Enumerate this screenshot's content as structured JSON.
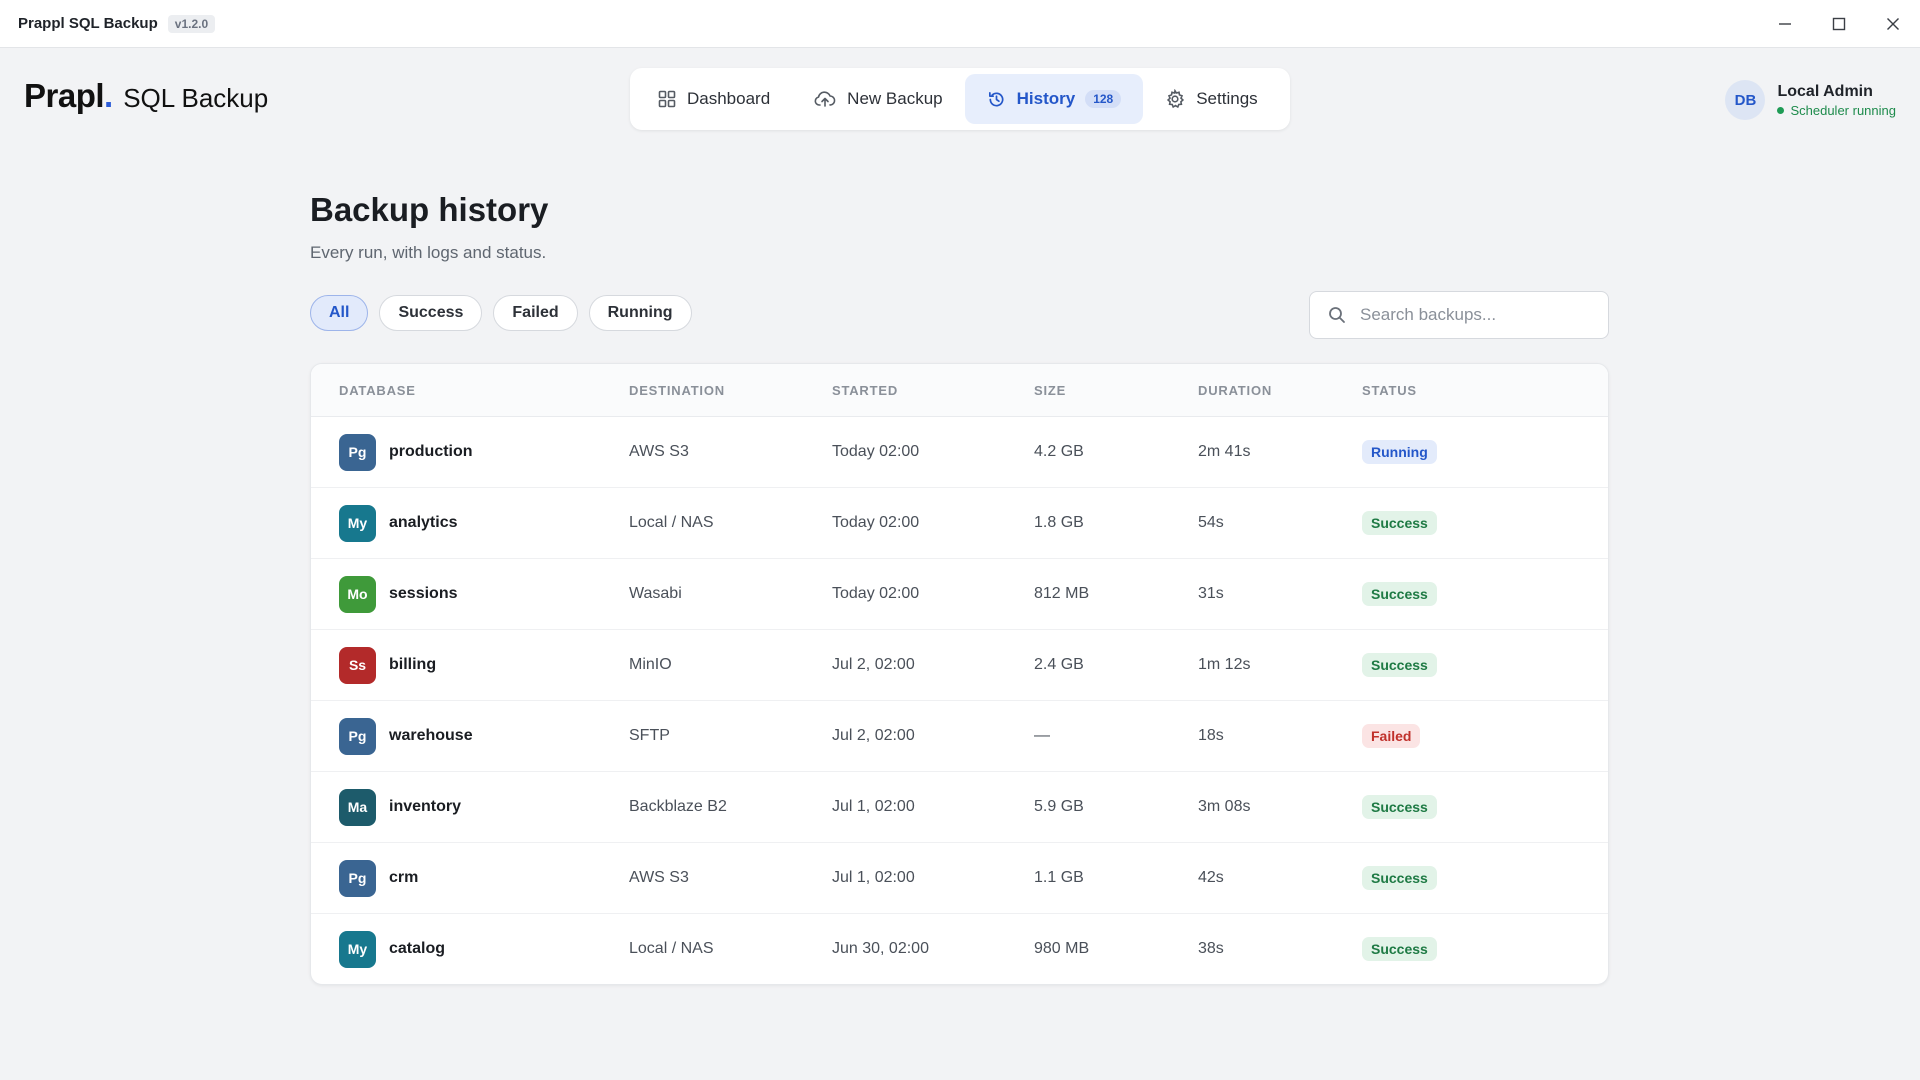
{
  "window": {
    "title": "Prappl SQL Backup",
    "version": "v1.2.0"
  },
  "brand": {
    "logo": "Prapl",
    "dot": ".",
    "product": "SQL Backup",
    "accent": "#2b5bd7"
  },
  "nav": {
    "items": [
      {
        "label": "Dashboard",
        "icon": "dashboard-icon"
      },
      {
        "label": "New Backup",
        "icon": "cloud-upload-icon"
      },
      {
        "label": "History",
        "icon": "history-icon",
        "badge": "128",
        "active": true
      },
      {
        "label": "Settings",
        "icon": "gear-icon"
      }
    ]
  },
  "user": {
    "initials": "DB",
    "name": "Local Admin",
    "status": "Scheduler running"
  },
  "page": {
    "title": "Backup history",
    "subtitle": "Every run, with logs and status."
  },
  "filters": {
    "chips": [
      "All",
      "Success",
      "Failed",
      "Running"
    ],
    "active": "All"
  },
  "search": {
    "placeholder": "Search backups...",
    "value": ""
  },
  "table": {
    "columns": [
      "DATABASE",
      "DESTINATION",
      "STARTED",
      "SIZE",
      "DURATION",
      "STATUS"
    ],
    "rows": [
      {
        "engine": "Pg",
        "engine_color": "#3a6592",
        "database": "production",
        "destination": "AWS S3",
        "started": "Today 02:00",
        "size": "4.2 GB",
        "duration": "2m 41s",
        "status": "Running"
      },
      {
        "engine": "My",
        "engine_color": "#17788e",
        "database": "analytics",
        "destination": "Local / NAS",
        "started": "Today 02:00",
        "size": "1.8 GB",
        "duration": "54s",
        "status": "Success"
      },
      {
        "engine": "Mo",
        "engine_color": "#3f9a3a",
        "database": "sessions",
        "destination": "Wasabi",
        "started": "Today 02:00",
        "size": "812 MB",
        "duration": "31s",
        "status": "Success"
      },
      {
        "engine": "Ss",
        "engine_color": "#b32a2a",
        "database": "billing",
        "destination": "MinIO",
        "started": "Jul 2, 02:00",
        "size": "2.4 GB",
        "duration": "1m 12s",
        "status": "Success"
      },
      {
        "engine": "Pg",
        "engine_color": "#3a6592",
        "database": "warehouse",
        "destination": "SFTP",
        "started": "Jul 2, 02:00",
        "size": "—",
        "duration": "18s",
        "status": "Failed"
      },
      {
        "engine": "Ma",
        "engine_color": "#1d5b6b",
        "database": "inventory",
        "destination": "Backblaze B2",
        "started": "Jul 1, 02:00",
        "size": "5.9 GB",
        "duration": "3m 08s",
        "status": "Success"
      },
      {
        "engine": "Pg",
        "engine_color": "#3a6592",
        "database": "crm",
        "destination": "AWS S3",
        "started": "Jul 1, 02:00",
        "size": "1.1 GB",
        "duration": "42s",
        "status": "Success"
      },
      {
        "engine": "My",
        "engine_color": "#17788e",
        "database": "catalog",
        "destination": "Local / NAS",
        "started": "Jun 30, 02:00",
        "size": "980 MB",
        "duration": "38s",
        "status": "Success"
      }
    ]
  }
}
